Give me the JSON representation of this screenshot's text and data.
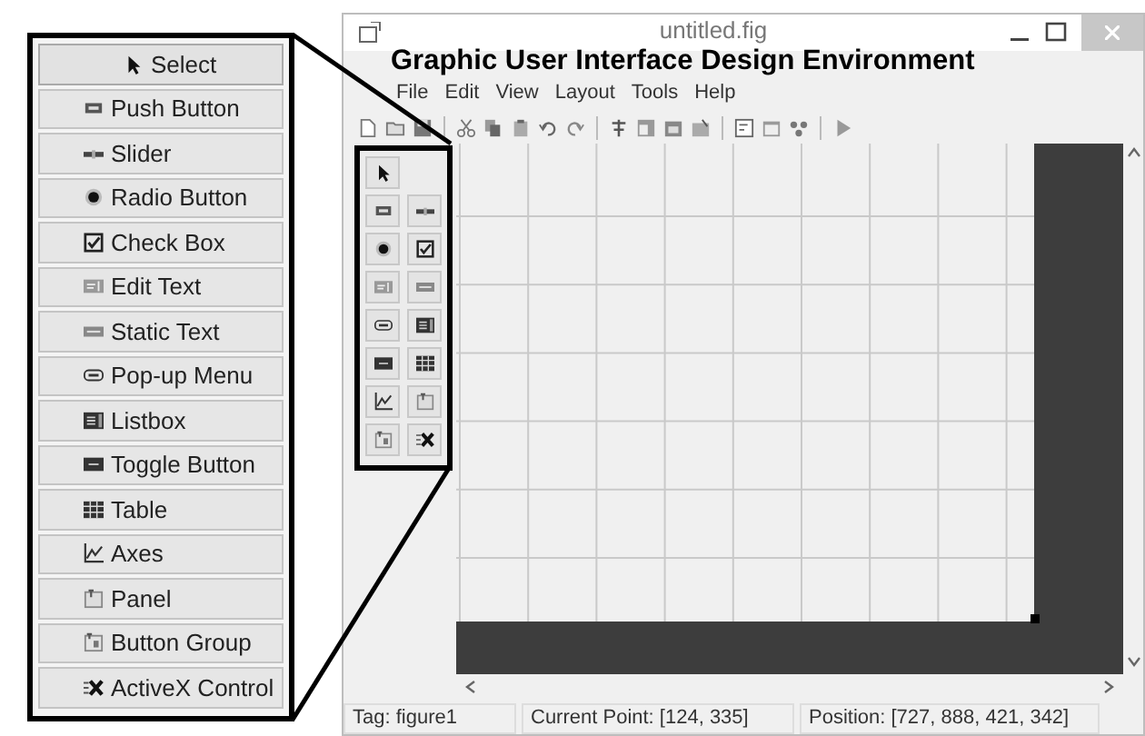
{
  "component_palette": {
    "items": [
      "Select",
      "Push Button",
      "Slider",
      "Radio Button",
      "Check Box",
      "Edit Text",
      "Static Text",
      "Pop-up Menu",
      "Listbox",
      "Toggle Button",
      "Table",
      "Axes",
      "Panel",
      "Button Group",
      "ActiveX Control"
    ]
  },
  "window": {
    "title": "untitled.fig",
    "caption": "Graphic User Interface Design Environment"
  },
  "menu": [
    "File",
    "Edit",
    "View",
    "Layout",
    "Tools",
    "Help"
  ],
  "status_bar": {
    "tag": "Tag: figure1",
    "current_point": "Current Point: [124, 335]",
    "position": "Position: [727, 888, 421, 342]"
  }
}
